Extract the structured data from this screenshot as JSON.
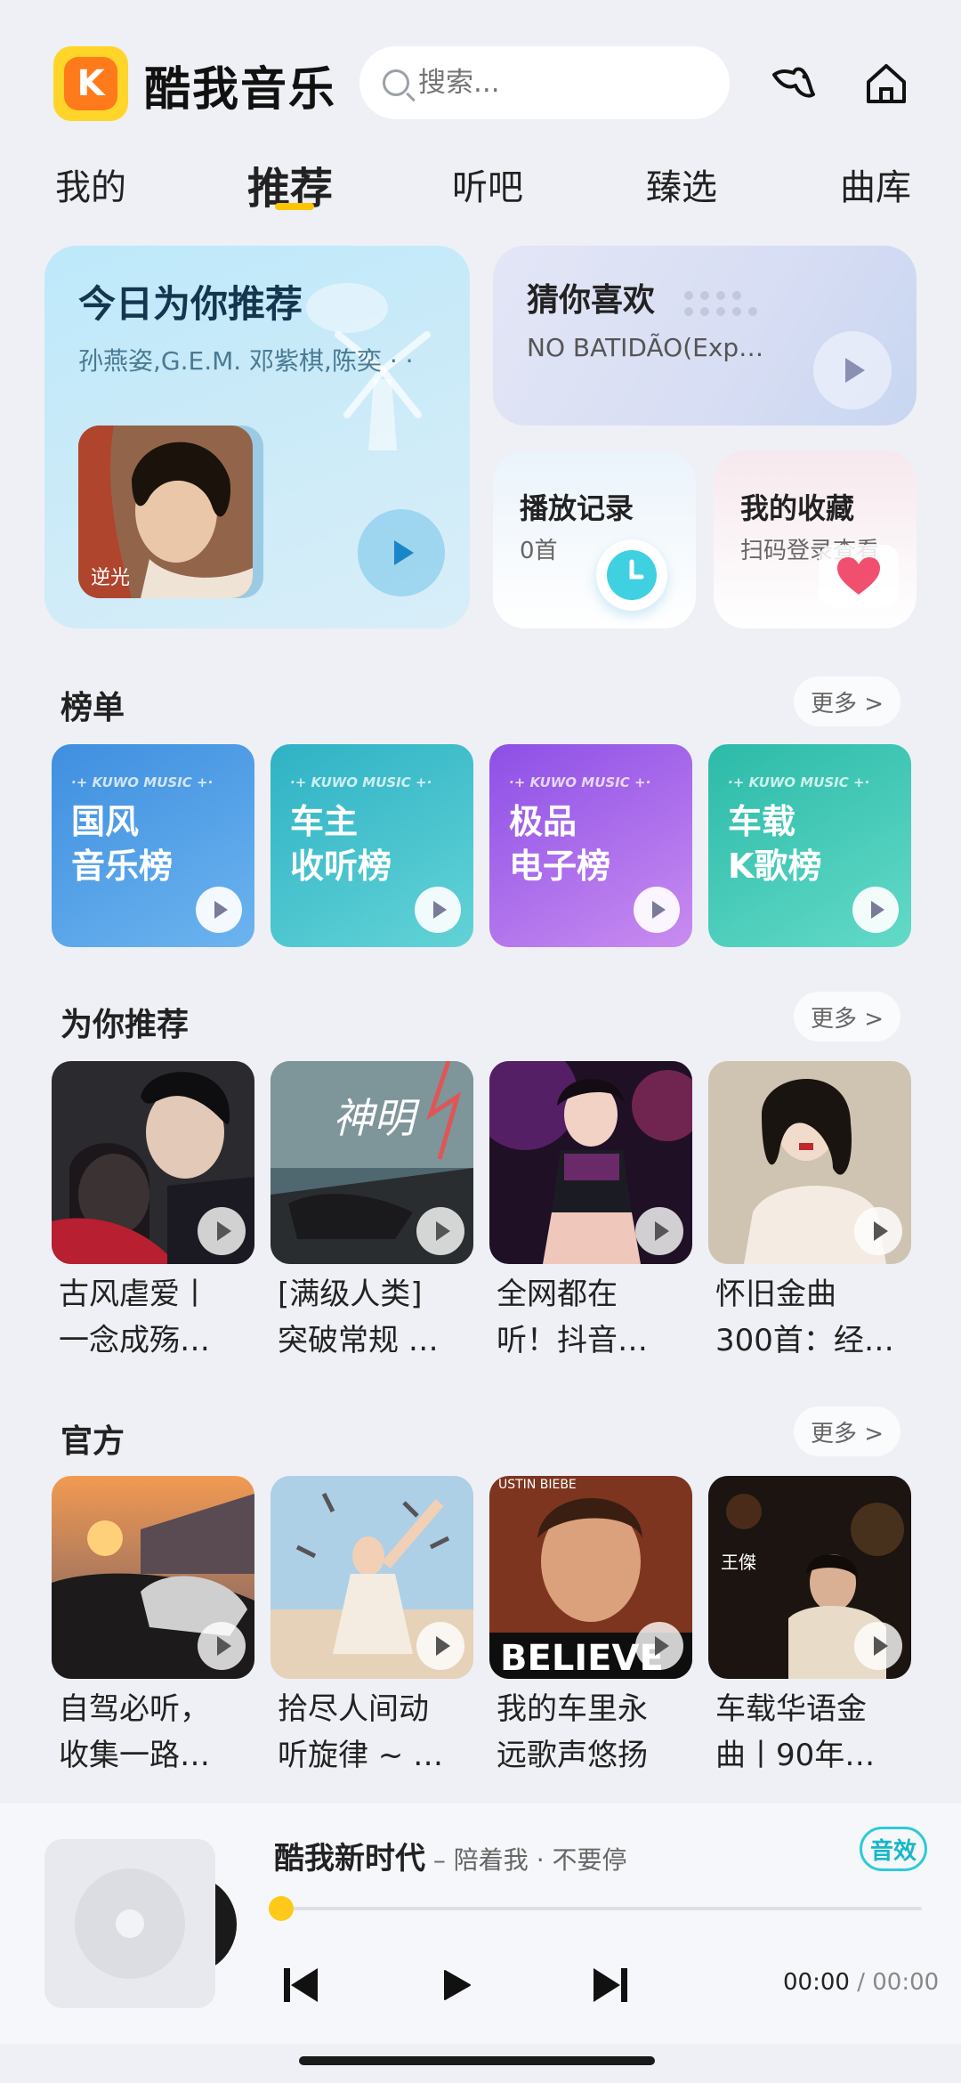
{
  "header": {
    "brand": "酷我音乐",
    "search_placeholder": "搜索..."
  },
  "tabs": [
    {
      "label": "我的"
    },
    {
      "label": "推荐",
      "active": true
    },
    {
      "label": "听吧"
    },
    {
      "label": "臻选"
    },
    {
      "label": "曲库"
    }
  ],
  "daily": {
    "title": "今日为你推荐",
    "subtitle": "孙燕姿,G.E.M. 邓紫棋,陈奕 · ·"
  },
  "guess": {
    "title": "猜你喜欢",
    "subtitle": "NO BATIDÃO(Exp…"
  },
  "history": {
    "title": "播放记录",
    "sub": "0首"
  },
  "favorites": {
    "title": "我的收藏",
    "sub": "扫码登录查看"
  },
  "charts": {
    "title": "榜单",
    "more": "更多 >",
    "brand_tag": "·+ KUWO MUSIC +·",
    "items": [
      {
        "line1": "国风",
        "line2": "音乐榜",
        "color_a": "#4a9be3",
        "color_b": "#6fb8ee"
      },
      {
        "line1": "车主",
        "line2": "收听榜",
        "color_a": "#36b9c9",
        "color_b": "#63d3d8"
      },
      {
        "line1": "极品",
        "line2": "电子榜",
        "color_a": "#9a5be8",
        "color_b": "#c38af0"
      },
      {
        "line1": "车载",
        "line2": "K歌榜",
        "color_a": "#2fc2ad",
        "color_b": "#62dac8"
      }
    ]
  },
  "for_you": {
    "title": "为你推荐",
    "more": "更多 >",
    "items": [
      {
        "line1": "古风虐爱丨",
        "line2": "一念成殇…"
      },
      {
        "line1": "[满级人类]",
        "line2": "突破常规 …"
      },
      {
        "line1": "全网都在",
        "line2": "听！抖音…"
      },
      {
        "line1": "怀旧金曲",
        "line2": "300首：经…"
      }
    ]
  },
  "official": {
    "title": "官方",
    "more": "更多 >",
    "items": [
      {
        "line1": "自驾必听，",
        "line2": "收集一路…"
      },
      {
        "line1": "拾尽人间动",
        "line2": "听旋律 ~ …"
      },
      {
        "line1": "我的车里永",
        "line2": "远歌声悠扬"
      },
      {
        "line1": "车载华语金",
        "line2": "曲丨90年…"
      }
    ]
  },
  "cover_text": {
    "shenming": "神明",
    "believe": "BELIEVE",
    "believe_top": "USTIN BIEBE",
    "wangjie": "王傑",
    "nixiang": "逆光"
  },
  "player": {
    "title": "酷我新时代",
    "sub": " – 陪着我 · 不要停",
    "fx": "音效",
    "time_current": "00:00",
    "time_sep": " / ",
    "time_total": "00:00",
    "progress": 0
  }
}
